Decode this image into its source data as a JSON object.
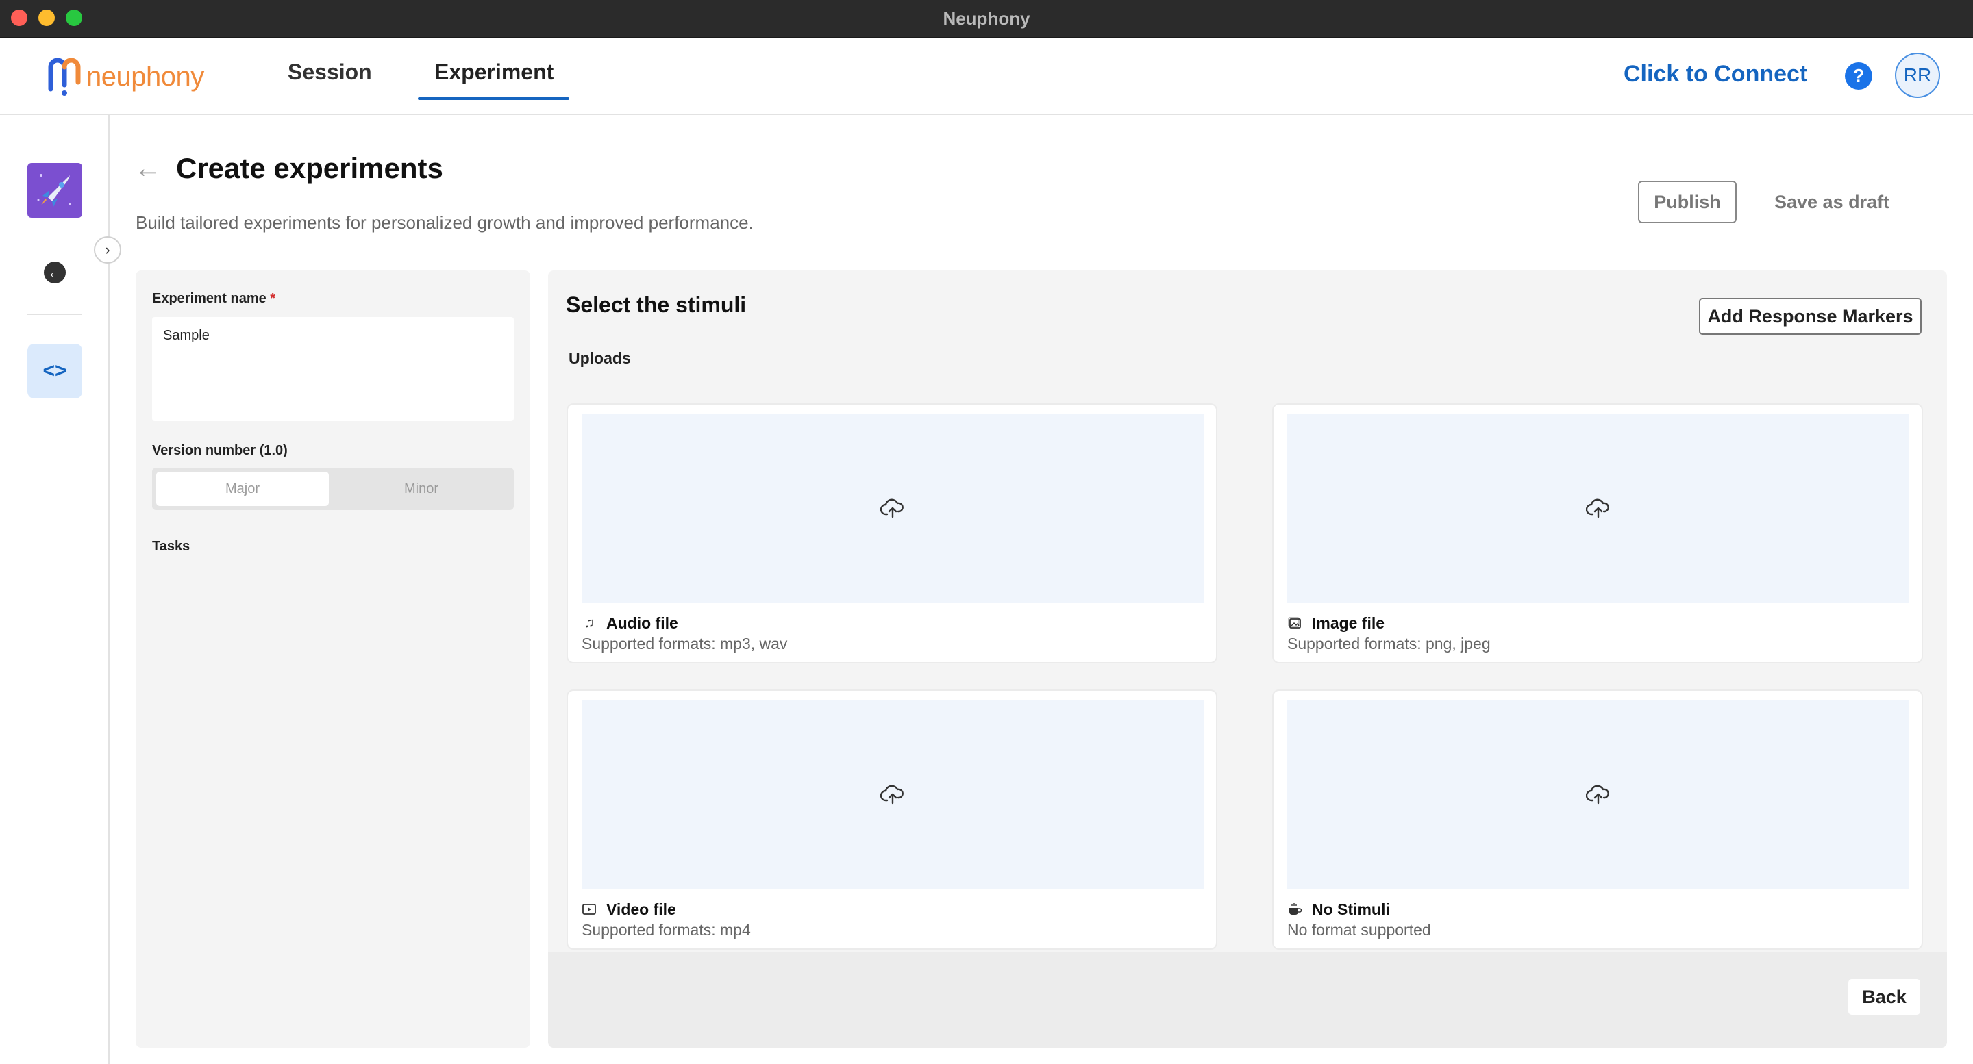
{
  "window": {
    "title": "Neuphony"
  },
  "nav": {
    "logo_text": "neuphony",
    "tabs": [
      {
        "label": "Session",
        "active": false
      },
      {
        "label": "Experiment",
        "active": true
      }
    ],
    "connect_label": "Click to Connect",
    "help_glyph": "?",
    "avatar_initials": "RR"
  },
  "rail": {
    "items": [
      {
        "icon": "rocket-icon"
      },
      {
        "icon": "back-arrow-icon"
      },
      {
        "icon": "code-icon"
      }
    ]
  },
  "header": {
    "title": "Create experiments",
    "subtitle": "Build tailored experiments for personalized growth and improved performance.",
    "publish_label": "Publish",
    "draft_label": "Save as draft"
  },
  "form": {
    "name_label": "Experiment name",
    "required_mark": "*",
    "name_value": "Sample",
    "version_label": "Version number (1.0)",
    "version_options": [
      "Major",
      "Minor"
    ],
    "version_selected": "Major",
    "tasks_label": "Tasks"
  },
  "stimuli": {
    "title": "Select the stimuli",
    "markers_label": "Add Response Markers",
    "uploads_label": "Uploads",
    "cards": [
      {
        "title": "Audio file",
        "formats": "Supported formats: mp3, wav",
        "icon": "music-note-icon"
      },
      {
        "title": "Image file",
        "formats": "Supported formats: png, jpeg",
        "icon": "image-icon"
      },
      {
        "title": "Video file",
        "formats": "Supported formats: mp4",
        "icon": "video-icon"
      },
      {
        "title": "No Stimuli",
        "formats": "No format supported",
        "icon": "cup-icon"
      }
    ],
    "back_label": "Back"
  },
  "colors": {
    "accent": "#1565c0",
    "logo_orange": "#f08a3a",
    "app_tile": "#7b4fd0",
    "drop_zone": "#f0f5fc"
  }
}
